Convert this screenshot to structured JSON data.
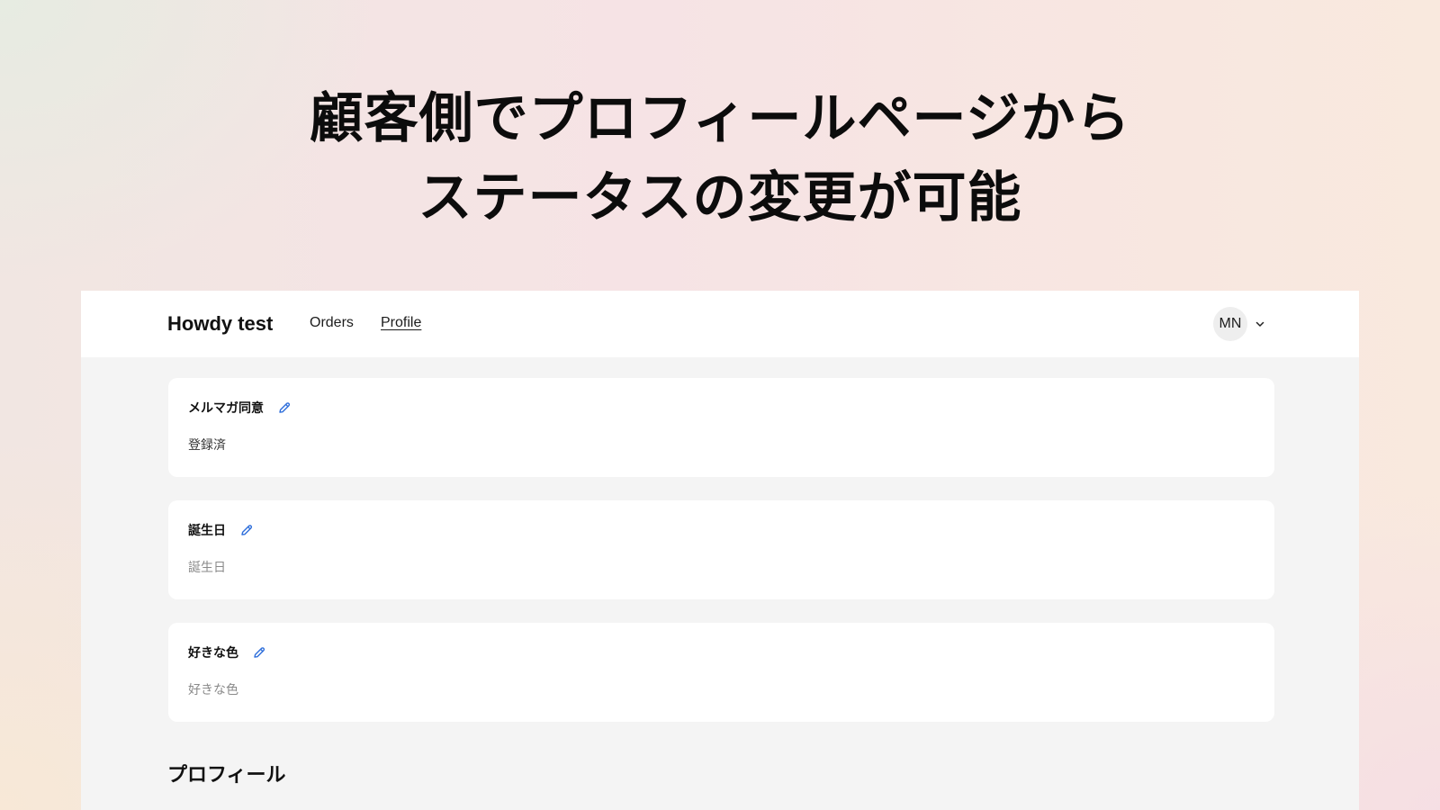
{
  "headline": {
    "line1": "顧客側でプロフィールページから",
    "line2": "ステータスの変更が可能"
  },
  "header": {
    "brand": "Howdy test",
    "nav": [
      {
        "label": "Orders",
        "active": false
      },
      {
        "label": "Profile",
        "active": true
      }
    ],
    "account": {
      "initials": "MN",
      "icon": "chevron-down-icon"
    }
  },
  "fields": [
    {
      "label": "メルマガ同意",
      "value": "登録済",
      "is_placeholder": false,
      "icon": "pencil-edit-icon"
    },
    {
      "label": "誕生日",
      "value": "誕生日",
      "is_placeholder": true,
      "icon": "pencil-edit-icon"
    },
    {
      "label": "好きな色",
      "value": "好きな色",
      "is_placeholder": true,
      "icon": "pencil-edit-icon"
    }
  ],
  "section": {
    "heading": "プロフィール"
  },
  "colors": {
    "accent": "#2f6fdb",
    "text": "#111111",
    "placeholder": "#8a8a8a",
    "panel_bg": "#f4f4f4",
    "card_bg": "#ffffff"
  }
}
